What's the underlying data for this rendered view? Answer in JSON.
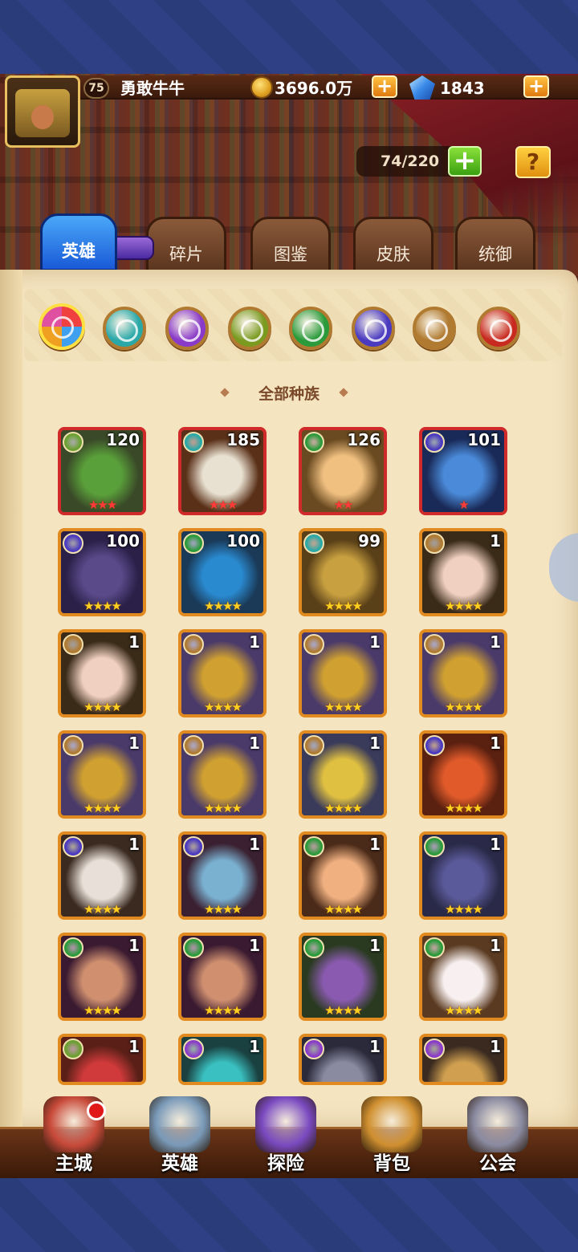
{
  "player": {
    "level": "75",
    "name": "勇敢牛牛"
  },
  "currency": {
    "gold": "3696.0万",
    "gems": "1843",
    "plus": "+"
  },
  "roster": {
    "count": "74/220",
    "plus": "+",
    "help": "?"
  },
  "tabs": [
    {
      "label": "英雄",
      "active": true
    },
    {
      "label": "碎片"
    },
    {
      "label": "图鉴"
    },
    {
      "label": "皮肤"
    },
    {
      "label": "统御"
    }
  ],
  "race_filter": {
    "label": "全部种族",
    "races": [
      {
        "icon": "all-races-icon",
        "color": "#f0a020"
      },
      {
        "icon": "cyan-race-icon",
        "color": "#2aa8a8"
      },
      {
        "icon": "purple-race-icon",
        "color": "#8a3ac8"
      },
      {
        "icon": "olive-race-icon",
        "color": "#7a9a20"
      },
      {
        "icon": "green-race-icon",
        "color": "#2a9a3a"
      },
      {
        "icon": "indigo-race-icon",
        "color": "#4a3ac0"
      },
      {
        "icon": "brown-race-icon",
        "color": "#b07a30"
      },
      {
        "icon": "red-race-icon",
        "color": "#c82a20"
      }
    ]
  },
  "heroes": [
    {
      "level": "120",
      "stars": "★★★",
      "race": "#6aa030",
      "frame": "red",
      "bg": "#3a4a28",
      "face": "#5aa03a"
    },
    {
      "level": "185",
      "stars": "★★★",
      "race": "#2aa8a8",
      "frame": "red",
      "bg": "#5a3018",
      "face": "#e8e0d0"
    },
    {
      "level": "126",
      "stars": "★★",
      "race": "#2a9a3a",
      "frame": "red",
      "bg": "#6a4a20",
      "face": "#f0c080"
    },
    {
      "level": "101",
      "stars": "★",
      "race": "#4a3ac0",
      "frame": "red",
      "bg": "#1a2a58",
      "face": "#4a8ad8"
    },
    {
      "level": "100",
      "stars": "★★★★",
      "race": "#4a3ac0",
      "frame": "orange",
      "bg": "#2a2048",
      "face": "#5a4a8a"
    },
    {
      "level": "100",
      "stars": "★★★★",
      "race": "#2a9a3a",
      "frame": "orange",
      "bg": "#1a3a58",
      "face": "#2a8ad0"
    },
    {
      "level": "99",
      "stars": "★★★★",
      "race": "#2aa8a8",
      "frame": "orange",
      "bg": "#5a4018",
      "face": "#c8a040"
    },
    {
      "level": "1",
      "stars": "★★★★",
      "race": "#b07a30",
      "frame": "orange",
      "bg": "#3a2a18",
      "face": "#f0d0c0"
    },
    {
      "level": "1",
      "stars": "★★★★",
      "race": "#b07a30",
      "frame": "orange",
      "bg": "#3a2a18",
      "face": "#f0d0c0"
    },
    {
      "level": "1",
      "stars": "★★★★",
      "race": "#b07a30",
      "frame": "orange",
      "bg": "#4a3a6a",
      "face": "#d0a030"
    },
    {
      "level": "1",
      "stars": "★★★★",
      "race": "#b07a30",
      "frame": "orange",
      "bg": "#4a3a6a",
      "face": "#d0a030"
    },
    {
      "level": "1",
      "stars": "★★★★",
      "race": "#b07a30",
      "frame": "orange",
      "bg": "#4a3a6a",
      "face": "#d0a030"
    },
    {
      "level": "1",
      "stars": "★★★★",
      "race": "#b07a30",
      "frame": "orange",
      "bg": "#4a3a6a",
      "face": "#d0a030"
    },
    {
      "level": "1",
      "stars": "★★★★",
      "race": "#b07a30",
      "frame": "orange",
      "bg": "#4a3a6a",
      "face": "#d0a030"
    },
    {
      "level": "1",
      "stars": "★★★★",
      "race": "#b07a30",
      "frame": "orange",
      "bg": "#3a3a5a",
      "face": "#e0c040"
    },
    {
      "level": "1",
      "stars": "★★★★",
      "race": "#4a3ac0",
      "frame": "orange",
      "bg": "#5a2010",
      "face": "#e05a2a"
    },
    {
      "level": "1",
      "stars": "★★★★",
      "race": "#4a3ac0",
      "frame": "orange",
      "bg": "#3a2a20",
      "face": "#e8e0d8"
    },
    {
      "level": "1",
      "stars": "★★★★",
      "race": "#4a3ac0",
      "frame": "orange",
      "bg": "#3a2030",
      "face": "#7ab0d0"
    },
    {
      "level": "1",
      "stars": "★★★★",
      "race": "#2a9a3a",
      "frame": "orange",
      "bg": "#4a2a18",
      "face": "#f0b080"
    },
    {
      "level": "1",
      "stars": "★★★★",
      "race": "#2a9a3a",
      "frame": "orange",
      "bg": "#2a2a48",
      "face": "#5a5a9a"
    },
    {
      "level": "1",
      "stars": "★★★★",
      "race": "#2a9a3a",
      "frame": "orange",
      "bg": "#3a1a30",
      "face": "#d09070"
    },
    {
      "level": "1",
      "stars": "★★★★",
      "race": "#2a9a3a",
      "frame": "orange",
      "bg": "#3a1a30",
      "face": "#d09070"
    },
    {
      "level": "1",
      "stars": "★★★★",
      "race": "#2a9a3a",
      "frame": "orange",
      "bg": "#2a3a20",
      "face": "#8a5ab0"
    },
    {
      "level": "1",
      "stars": "★★★★",
      "race": "#2a9a3a",
      "frame": "orange",
      "bg": "#5a3a20",
      "face": "#f8f0f0"
    },
    {
      "level": "1",
      "stars": "",
      "race": "#6aa030",
      "frame": "orange",
      "bg": "#5a2018",
      "face": "#d03a3a"
    },
    {
      "level": "1",
      "stars": "",
      "race": "#8a3ac8",
      "frame": "orange",
      "bg": "#1a4040",
      "face": "#3ac0c0"
    },
    {
      "level": "1",
      "stars": "",
      "race": "#8a3ac8",
      "frame": "orange",
      "bg": "#2a2a3a",
      "face": "#8a8aa0"
    },
    {
      "level": "1",
      "stars": "",
      "race": "#8a3ac8",
      "frame": "orange",
      "bg": "#3a2a20",
      "face": "#d0a050"
    }
  ],
  "nav": [
    {
      "label": "主城",
      "icon": "castle-icon",
      "color": "#c84a3a"
    },
    {
      "label": "英雄",
      "icon": "hero-portrait-icon",
      "color": "#7a9ab8"
    },
    {
      "label": "探险",
      "icon": "portal-icon",
      "color": "#7a4ac0"
    },
    {
      "label": "背包",
      "icon": "backpack-icon",
      "color": "#d09030"
    },
    {
      "label": "公会",
      "icon": "guild-tower-icon",
      "color": "#8a8aa0"
    }
  ]
}
